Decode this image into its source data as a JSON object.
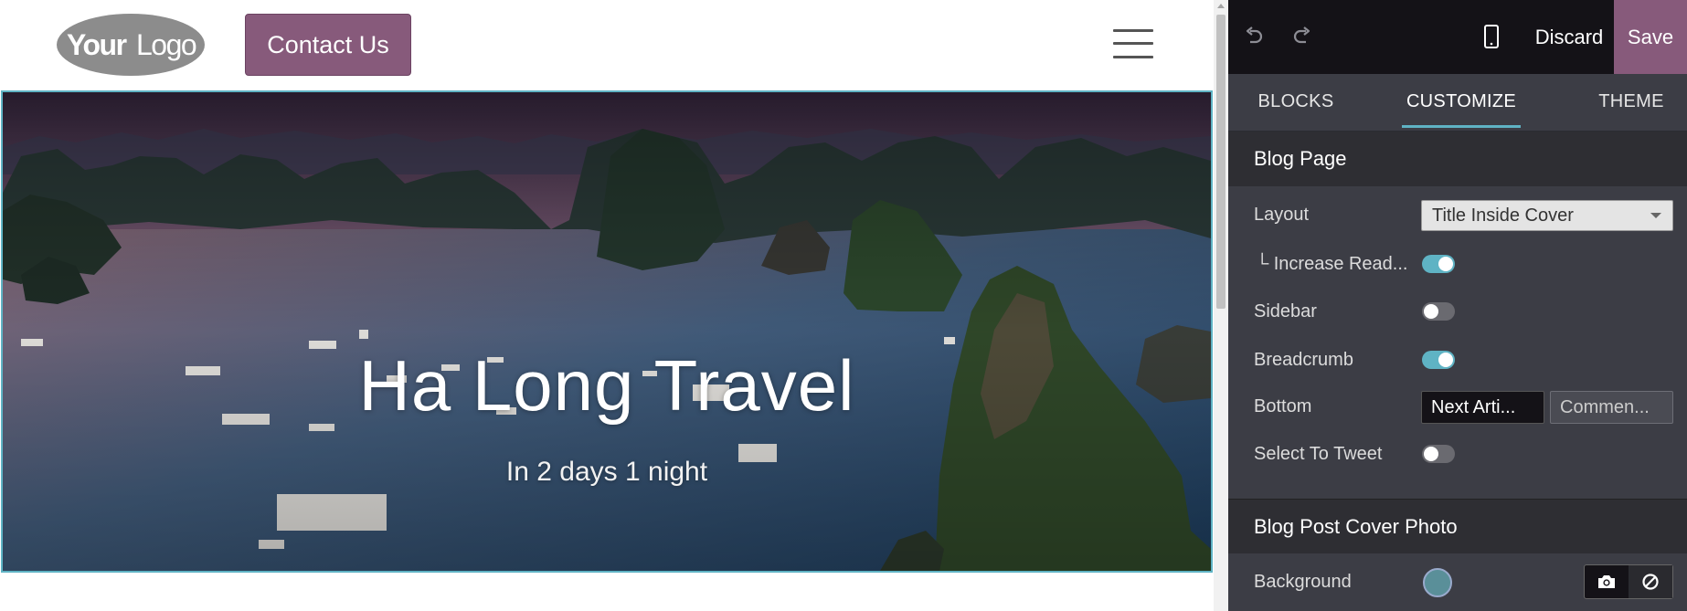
{
  "site": {
    "logo_text_your": "Your",
    "logo_text_logo": "Logo",
    "contact_label": "Contact Us",
    "hero": {
      "title": "Ha Long Travel",
      "subtitle": "In 2 days 1 night"
    }
  },
  "toolbar": {
    "discard_label": "Discard",
    "save_label": "Save"
  },
  "tabs": [
    {
      "label": "BLOCKS"
    },
    {
      "label": "CUSTOMIZE",
      "active": true
    },
    {
      "label": "THEME"
    }
  ],
  "sections": [
    {
      "title": "Blog Page",
      "options": {
        "layout": {
          "label": "Layout",
          "value": "Title Inside Cover"
        },
        "increase_readability": {
          "label": "└ Increase Read...",
          "on": true
        },
        "sidebar": {
          "label": "Sidebar",
          "on": false
        },
        "breadcrumb": {
          "label": "Breadcrumb",
          "on": true
        },
        "bottom": {
          "label": "Bottom",
          "buttons": [
            "Next Arti...",
            "Commen..."
          ],
          "selected": "Next Arti..."
        },
        "select_to_tweet": {
          "label": "Select To Tweet",
          "on": false
        }
      }
    },
    {
      "title": "Blog Post Cover Photo",
      "options": {
        "background": {
          "label": "Background",
          "color": "#5a8f99"
        }
      }
    }
  ],
  "colors": {
    "accent": "#5fb3c4",
    "brand": "#875a7b",
    "panel_bg": "#3c3d45"
  }
}
